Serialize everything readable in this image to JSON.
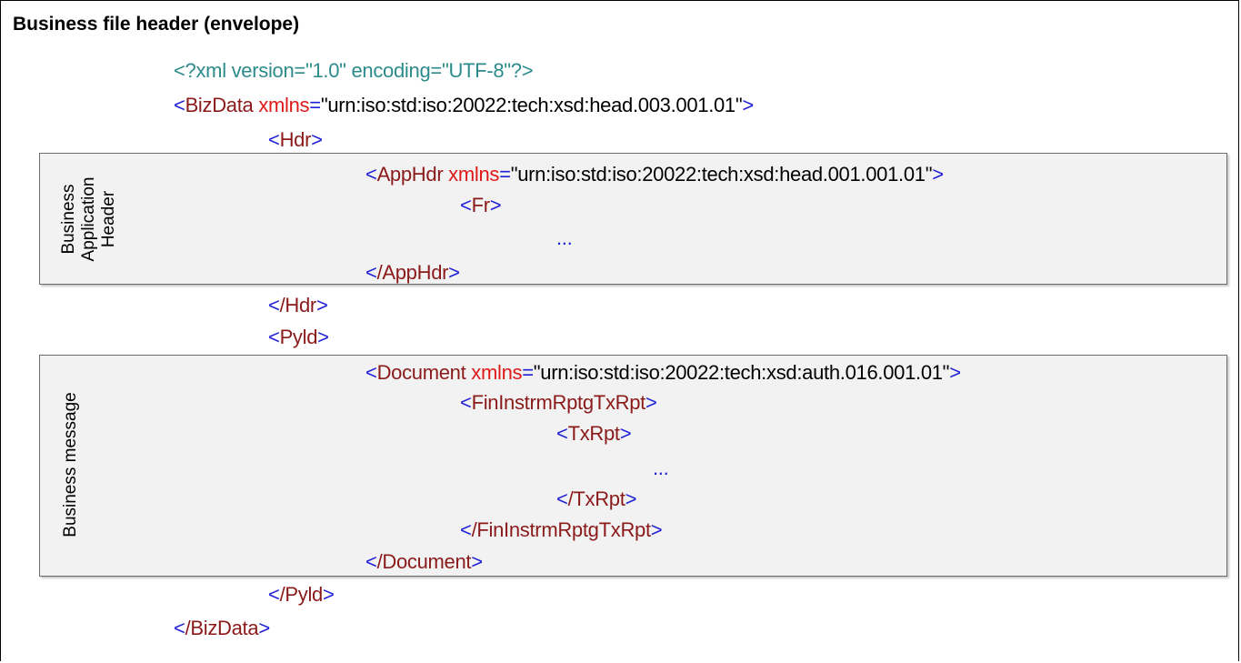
{
  "title": "Business file header (envelope)",
  "sections": {
    "bah_label_1": "Business",
    "bah_label_2": "Application",
    "bah_label_3": "Header",
    "msg_label": "Business message"
  },
  "xml": {
    "decl": "<?xml version=\"1.0\" encoding=\"UTF-8\"?>",
    "bizdata_tag": "BizData",
    "attr": "xmlns",
    "bizdata_ns": "\"urn:iso:std:iso:20022:tech:xsd:head.003.001.01\"",
    "hdr": "Hdr",
    "apphdr_tag": "AppHdr",
    "apphdr_ns": "\"urn:iso:std:iso:20022:tech:xsd:head.001.001.01\"",
    "fr": "Fr",
    "ellipsis": "...",
    "apphdr_close": "/AppHdr",
    "hdr_close": "/Hdr",
    "pyld": "Pyld",
    "document_tag": "Document",
    "document_ns": "\"urn:iso:std:iso:20022:tech:xsd:auth.016.001.01\"",
    "fin": "FinInstrmRptgTxRpt",
    "txrpt": "TxRpt",
    "txrpt_close": "/TxRpt",
    "fin_close": "/FinInstrmRptgTxRpt",
    "document_close": "/Document",
    "pyld_close": "/Pyld",
    "bizdata_close": "/BizData"
  },
  "colors": {
    "bracket": "#1f1fd6",
    "tag": "#8b1a1a",
    "attribute": "#e01818",
    "declaration": "#2e8b8b",
    "panel_fill": "#f2f2f2"
  }
}
